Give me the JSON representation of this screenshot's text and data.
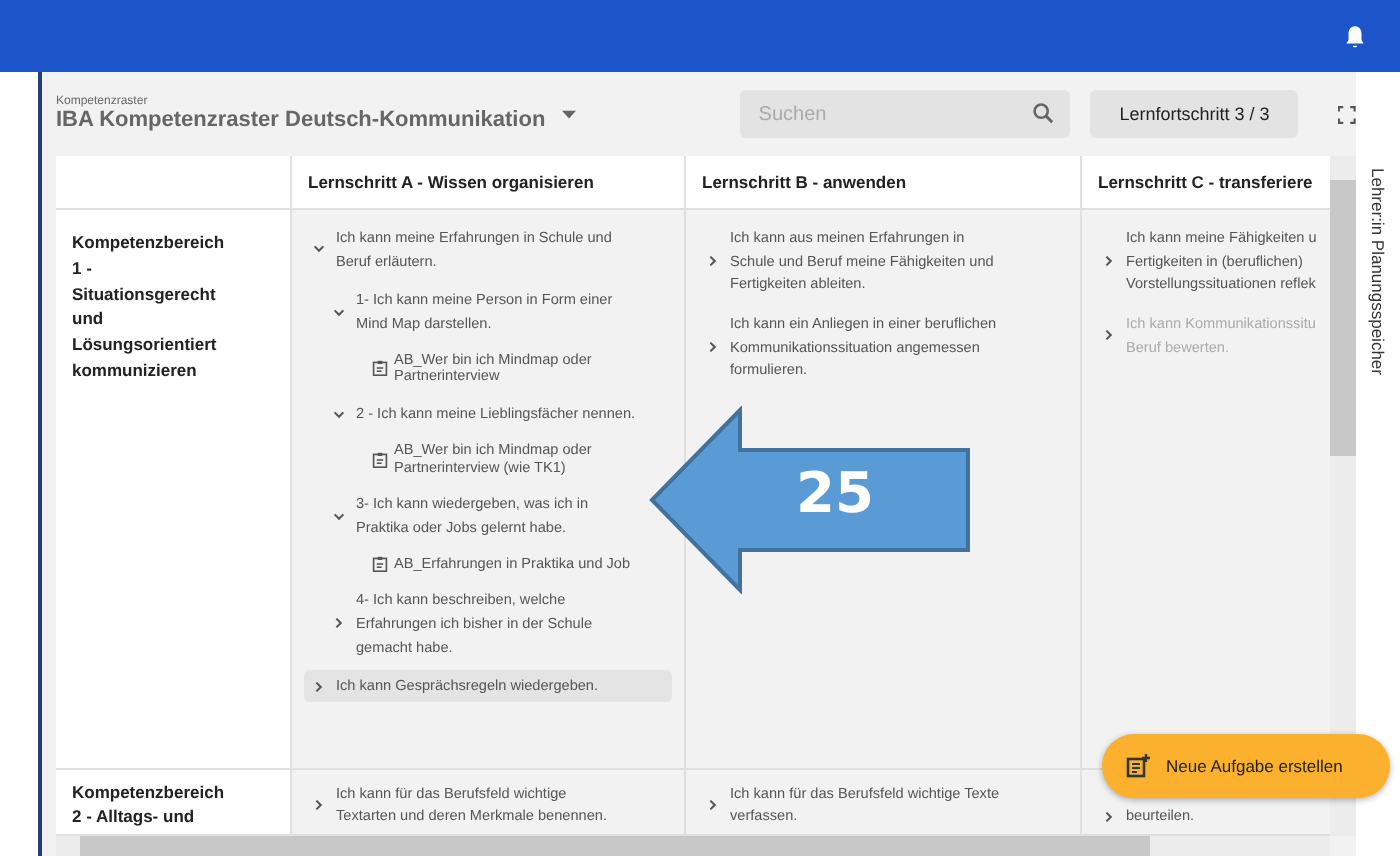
{
  "header": {
    "overline": "Kompetenzraster",
    "title": "IBA Kompetenzraster Deutsch-Kommunikation",
    "search": {
      "placeholder": "Suchen"
    },
    "progress_button": "Lernfortschritt 3 / 3"
  },
  "table": {
    "columns": [
      "Lernschritt A - Wissen organisieren",
      "Lernschritt B - anwenden",
      "Lernschritt C - transferiere"
    ],
    "rows": [
      {
        "label": "Kompetenzbereich 1 - Situationsgerecht und Lösungsorientiert kommunizieren",
        "cells": [
          [
            {
              "kind": "group",
              "text": "Ich kann meine Erfahrungen in Schule und Beruf erläutern.",
              "expanded": true,
              "selected": false,
              "disabled": false,
              "children": [
                {
                  "kind": "group",
                  "text": "1- Ich kann meine Person in Form einer Mind Map darstellen.",
                  "expanded": true,
                  "selected": false,
                  "disabled": false,
                  "children": [
                    {
                      "kind": "document",
                      "text": "AB_Wer bin ich Mindmap oder Partnerinterview"
                    }
                  ]
                },
                {
                  "kind": "group",
                  "text": "2 - Ich kann meine Lieblingsfächer nennen.",
                  "expanded": true,
                  "selected": false,
                  "disabled": false,
                  "children": [
                    {
                      "kind": "document",
                      "text": "AB_Wer bin ich Mindmap oder Partnerinterview (wie TK1)"
                    }
                  ]
                },
                {
                  "kind": "group",
                  "text": "3- Ich kann wiedergeben, was ich in Praktika oder Jobs gelernt habe.",
                  "expanded": true,
                  "selected": false,
                  "disabled": false,
                  "children": [
                    {
                      "kind": "document",
                      "text": "AB_Erfahrungen in Praktika und Job"
                    }
                  ]
                },
                {
                  "kind": "group",
                  "text": "4- Ich kann beschreiben, welche Erfahrungen ich bisher in der Schule gemacht habe.",
                  "expanded": false,
                  "selected": false,
                  "disabled": false
                }
              ]
            },
            {
              "kind": "group",
              "text": "Ich kann Gesprächsregeln wiedergeben.",
              "expanded": false,
              "selected": true,
              "disabled": false
            }
          ],
          [
            {
              "kind": "group",
              "text": "Ich kann aus meinen Erfahrungen in Schule und Beruf meine Fähigkeiten und Fertigkeiten ableiten.",
              "expanded": false,
              "selected": false,
              "disabled": false
            },
            {
              "kind": "group",
              "text": "Ich kann ein Anliegen in einer beruflichen Kommunikationssituation angemessen formulieren.",
              "expanded": false,
              "selected": false,
              "disabled": false
            }
          ],
          [
            {
              "kind": "group",
              "text": "Ich kann meine Fähigkeiten u\nFertigkeiten in (beruflichen)\nVorstellungssituationen reflek",
              "expanded": false,
              "selected": false,
              "disabled": false
            },
            {
              "kind": "group",
              "text": "Ich kann Kommunikationssitu\nBeruf bewerten.",
              "expanded": false,
              "selected": false,
              "disabled": true
            }
          ]
        ]
      },
      {
        "label": "Kompetenzbereich 2 - Alltags- und",
        "cells": [
          [
            {
              "kind": "group",
              "text": "Ich kann für das Berufsfeld wichtige Textarten und deren Merkmale benennen.",
              "expanded": false,
              "selected": false,
              "disabled": false
            }
          ],
          [
            {
              "kind": "group",
              "text": "Ich kann für das Berufsfeld wichtige Texte verfassen.",
              "expanded": false,
              "selected": false,
              "disabled": false
            }
          ],
          [
            {
              "kind": "group",
              "text": "beurteilen.",
              "expanded": false,
              "selected": false,
              "disabled": false
            }
          ]
        ]
      }
    ]
  },
  "side_panel": {
    "label": "Lehrer:in Planungsspeicher"
  },
  "annotation": {
    "label": "25"
  },
  "fab": {
    "label": "Neue Aufgabe erstellen"
  }
}
